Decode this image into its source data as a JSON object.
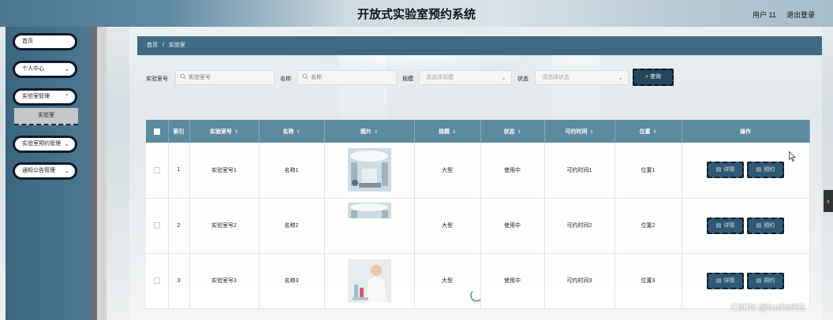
{
  "header": {
    "title": "开放式实验室预约系统",
    "user": "用户 11",
    "logout": "退出登录"
  },
  "sidebar": {
    "items": [
      {
        "label": "首页",
        "has_chevron": false
      },
      {
        "label": "个人中心",
        "has_chevron": true
      },
      {
        "label": "实验室管理",
        "has_chevron": true
      },
      {
        "label": "实验室预约管理",
        "has_chevron": true
      },
      {
        "label": "通知公告管理",
        "has_chevron": true
      }
    ],
    "active_sub": "实验室"
  },
  "breadcrumb": {
    "home": "首页",
    "separator": "/",
    "current": "实验室"
  },
  "filters": {
    "lab_no": {
      "label": "实验室号",
      "placeholder": "实验室号"
    },
    "name": {
      "label": "名称",
      "placeholder": "名称"
    },
    "scale": {
      "label": "规模",
      "placeholder": "请选择规模"
    },
    "status": {
      "label": "状态",
      "placeholder": "请选择状态"
    },
    "search_label": "查询"
  },
  "table": {
    "columns": [
      "索引",
      "实验室号",
      "名称",
      "图片",
      "规模",
      "状态",
      "可约时间",
      "位置",
      "操作"
    ],
    "rows": [
      {
        "index": "1",
        "lab_no": "实验室号1",
        "name": "名称1",
        "image": "lab-corridor-photo",
        "scale": "大型",
        "status": "使用中",
        "time": "可约时间1",
        "location": "位置1"
      },
      {
        "index": "2",
        "lab_no": "实验室号2",
        "name": "名称2",
        "image": "lab-corridor-photo",
        "scale": "大型",
        "status": "使用中",
        "time": "可约时间2",
        "location": "位置2"
      },
      {
        "index": "3",
        "lab_no": "实验室号3",
        "name": "名称3",
        "image": "lab-scientist-photo",
        "scale": "大型",
        "status": "使用中",
        "time": "可约时间3",
        "location": "位置3"
      }
    ],
    "actions": {
      "detail": "详情",
      "reserve": "预约"
    }
  },
  "watermark": "CSDN @bushe902",
  "colors": {
    "accent": "#3e6b83",
    "header_row": "#5c8aa0",
    "button": "#2f5974"
  }
}
